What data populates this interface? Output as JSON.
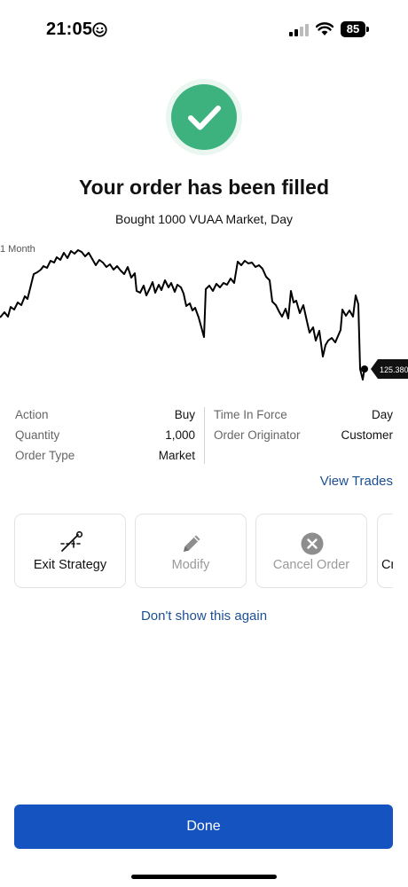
{
  "status_bar": {
    "time": "21:05",
    "battery": "85",
    "icons": [
      "smiley-icon",
      "cellular-signal-icon",
      "wifi-icon",
      "battery-icon"
    ]
  },
  "success": {
    "icon": "checkmark-icon",
    "color": "#3db27f",
    "title": "Your order has been filled",
    "subtitle": "Bought 1000 VUAA Market, Day"
  },
  "chart_data": {
    "type": "line",
    "range_label": "1 Month",
    "last_price_label": "125.3800",
    "last_value": 125.38,
    "grid": false,
    "line_color": "#000000",
    "y_axis_labels_shown": false
  },
  "details": {
    "left": [
      {
        "key": "Action",
        "value": "Buy"
      },
      {
        "key": "Quantity",
        "value": "1,000"
      },
      {
        "key": "Order Type",
        "value": "Market"
      }
    ],
    "right": [
      {
        "key": "Time In Force",
        "value": "Day"
      },
      {
        "key": "Order Originator",
        "value": "Customer"
      }
    ]
  },
  "view_trades_label": "View Trades",
  "actions": [
    {
      "label": "Exit Strategy",
      "icon": "exit-strategy-icon",
      "enabled": true
    },
    {
      "label": "Modify",
      "icon": "pencil-icon",
      "enabled": false
    },
    {
      "label": "Cancel Order",
      "icon": "cancel-icon",
      "enabled": false
    },
    {
      "label": "Cr",
      "icon": "",
      "enabled": true
    }
  ],
  "dont_show_label": "Don't show this again",
  "done_label": "Done",
  "colors": {
    "link": "#1c4f94",
    "primary_button": "#1553c0",
    "disabled_text": "#9a9a9a"
  }
}
